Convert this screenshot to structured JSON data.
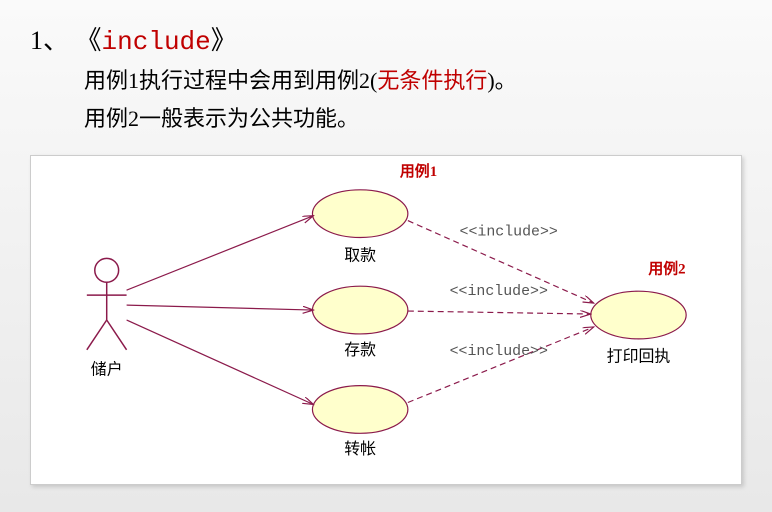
{
  "header": {
    "number": "1、",
    "bracket_open": "《",
    "keyword": "include",
    "bracket_close": "》",
    "line1_prefix": "用例1执行过程中会用到用例2(",
    "line1_highlight": "无条件执行",
    "line1_suffix": ")。",
    "line2": "用例2一般表示为公共功能。"
  },
  "diagram": {
    "actor": {
      "name": "储户"
    },
    "usecases": {
      "withdraw": "取款",
      "deposit": "存款",
      "transfer": "转帐",
      "print": "打印回执"
    },
    "annotations": {
      "uc1": "用例1",
      "uc2": "用例2"
    },
    "stereotype": "<<include>>"
  }
}
